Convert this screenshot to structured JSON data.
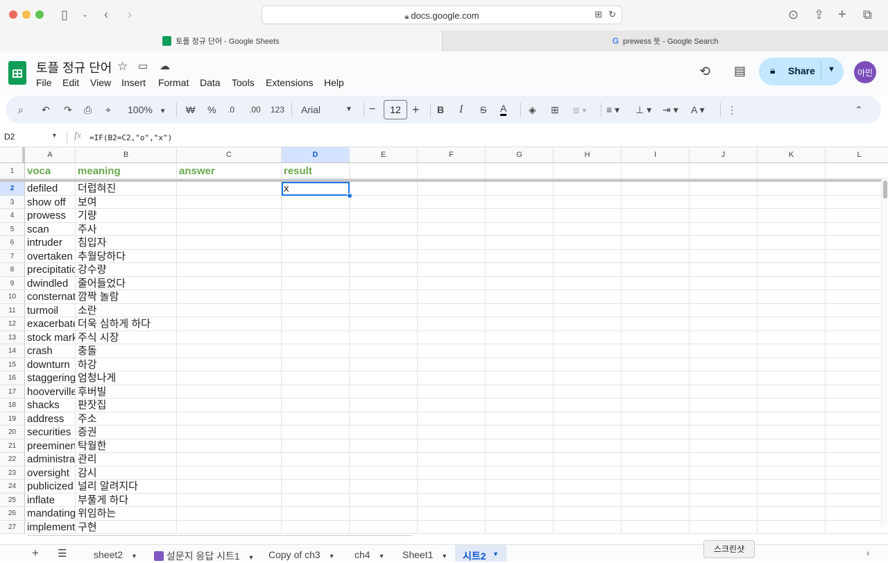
{
  "browser": {
    "address": "docs.google.com",
    "tabs": [
      {
        "label": "토플 정규 단어 - Google Sheets",
        "active": true
      },
      {
        "label": "prewess 뜻 - Google Search",
        "active": false
      }
    ]
  },
  "sheets": {
    "title": "토플 정규 단어",
    "menu": [
      "File",
      "Edit",
      "View",
      "Insert",
      "Format",
      "Data",
      "Tools",
      "Extensions",
      "Help"
    ],
    "share_label": "Share",
    "avatar": "아민"
  },
  "toolbar": {
    "zoom": "100%",
    "currency": "₩",
    "percent": "%",
    "dec_decrease": ".0",
    "dec_increase": ".00",
    "number_format": "123",
    "font": "Arial",
    "font_size": "12",
    "bold": "B",
    "italic": "I",
    "strike": "S",
    "text_color": "A"
  },
  "formula": {
    "cell_ref": "D2",
    "fx": "fx",
    "formula": "=IF(B2=C2,\"o\",\"x\")"
  },
  "columns": [
    "A",
    "B",
    "C",
    "D",
    "E",
    "F",
    "G",
    "H",
    "I",
    "J",
    "K",
    "L"
  ],
  "header_row": {
    "voca": "voca",
    "meaning": "meaning",
    "answer": "answer",
    "result": "result"
  },
  "rows": [
    {
      "n": "2",
      "a": "defiled",
      "b": "더럽혀진",
      "d": "x"
    },
    {
      "n": "3",
      "a": "show off",
      "b": "보여",
      "d": ""
    },
    {
      "n": "4",
      "a": "prowess",
      "b": "기량",
      "d": ""
    },
    {
      "n": "5",
      "a": "scan",
      "b": "주사",
      "d": ""
    },
    {
      "n": "6",
      "a": "intruder",
      "b": "침입자",
      "d": ""
    },
    {
      "n": "7",
      "a": "overtaken",
      "b": "추월당하다",
      "d": ""
    },
    {
      "n": "8",
      "a": "precipitation",
      "b": "강수량",
      "d": ""
    },
    {
      "n": "9",
      "a": "dwindled",
      "b": "줄어들었다",
      "d": ""
    },
    {
      "n": "10",
      "a": "consternation",
      "b": "깜짝 놀람",
      "d": ""
    },
    {
      "n": "11",
      "a": "turmoil",
      "b": "소란",
      "d": ""
    },
    {
      "n": "12",
      "a": "exacerbate",
      "b": "더욱 심하게 하다",
      "d": ""
    },
    {
      "n": "13",
      "a": "stock market",
      "b": "주식 시장",
      "d": ""
    },
    {
      "n": "14",
      "a": "crash",
      "b": "충돌",
      "d": ""
    },
    {
      "n": "15",
      "a": "downturn",
      "b": "하강",
      "d": ""
    },
    {
      "n": "16",
      "a": "staggeringly",
      "b": "엄청나게",
      "d": ""
    },
    {
      "n": "17",
      "a": "hoovervilles",
      "b": "후버빌",
      "d": ""
    },
    {
      "n": "18",
      "a": "shacks",
      "b": "판잣집",
      "d": ""
    },
    {
      "n": "19",
      "a": "address",
      "b": "주소",
      "d": ""
    },
    {
      "n": "20",
      "a": "securities",
      "b": "증권",
      "d": ""
    },
    {
      "n": "21",
      "a": "preeminent",
      "b": "탁월한",
      "d": ""
    },
    {
      "n": "22",
      "a": "administration",
      "b": "관리",
      "d": ""
    },
    {
      "n": "23",
      "a": "oversight",
      "b": "감시",
      "d": ""
    },
    {
      "n": "24",
      "a": "publicized",
      "b": "널리 알려지다",
      "d": ""
    },
    {
      "n": "25",
      "a": "inflate",
      "b": "부풀게 하다",
      "d": ""
    },
    {
      "n": "26",
      "a": "mandating",
      "b": "위임하는",
      "d": ""
    },
    {
      "n": "27",
      "a": "implementing",
      "b": "구현",
      "d": ""
    }
  ],
  "sheet_tabs": [
    "sheet2",
    "설문지 응답 시트1",
    "Copy of ch3",
    "ch4",
    "Sheet1",
    "시트2"
  ],
  "tooltip": "스크린샷",
  "colors": {
    "header_green": "#6aa84f",
    "accent_blue": "#1a73e8",
    "share_bg": "#c2e7ff",
    "selected_col_bg": "#d3e3fd"
  }
}
